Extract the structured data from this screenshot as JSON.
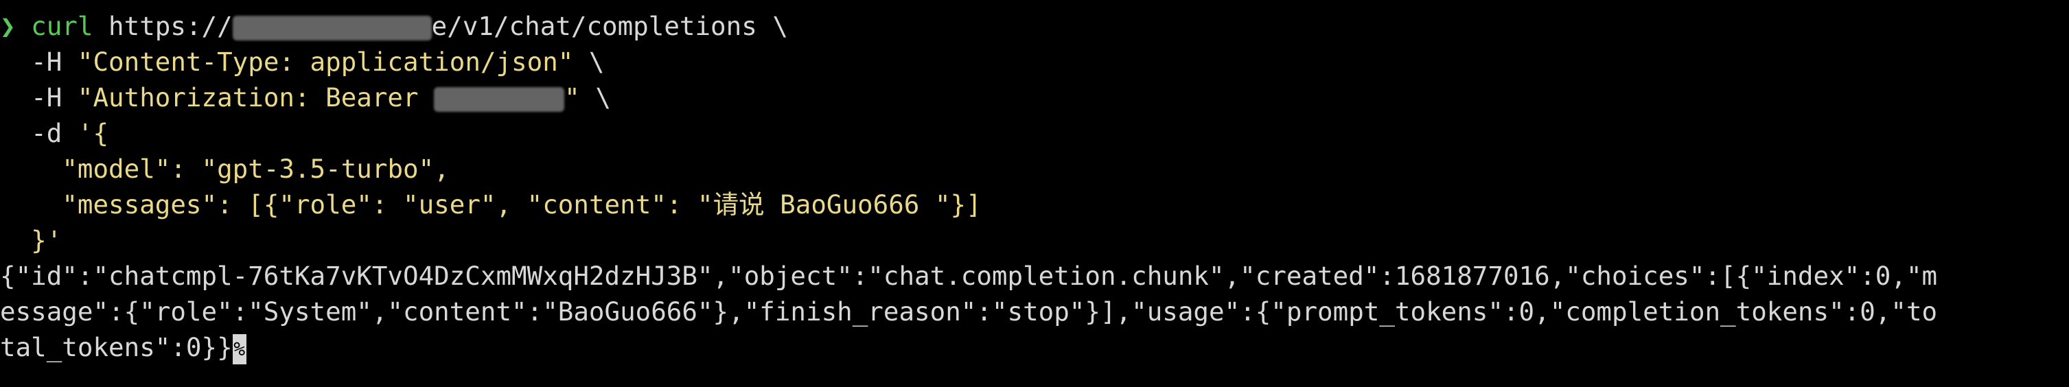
{
  "colors": {
    "background": "#000000",
    "text": "#d8d8d8",
    "prompt": "#5ac95a",
    "string": "#ead98b",
    "redaction": "#6f6f6f"
  },
  "prompt": {
    "symbol": "❯"
  },
  "command": {
    "name": "curl",
    "url_prefix": "https://",
    "url_suffix": "e/v1/chat/completions",
    "continuation": " \\",
    "header1_flag": "-H",
    "header1_value": "\"Content-Type: application/json\"",
    "header2_flag": "-H",
    "header2_prefix": "\"Authorization: Bearer ",
    "header2_suffix": "\"",
    "data_flag": "-d",
    "data_open": "'{",
    "model_key": "\"model\"",
    "model_value": "\"gpt-3.5-turbo\"",
    "messages_key": "\"messages\"",
    "messages_prefix": "[{",
    "role_key": "\"role\"",
    "role_value": "\"user\"",
    "content_key": "\"content\"",
    "content_value": "\"请说 BaoGuo666 \"",
    "messages_suffix": "}]",
    "data_close": "}'"
  },
  "output": {
    "line1": "{\"id\":\"chatcmpl-76tKa7vKTvO4DzCxmMWxqH2dzHJ3B\",\"object\":\"chat.completion.chunk\",\"created\":1681877016,\"choices\":[{\"index\":0,\"m",
    "line2": "essage\":{\"role\":\"System\",\"content\":\"BaoGuo666\"},\"finish_reason\":\"stop\"}],\"usage\":{\"prompt_tokens\":0,\"completion_tokens\":0,\"to",
    "line3": "tal_tokens\":0}}",
    "eol_marker": "%"
  }
}
